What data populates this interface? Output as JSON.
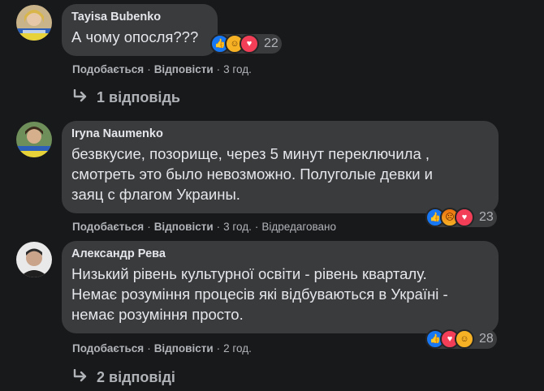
{
  "comments": [
    {
      "author": "Tayisa Bubenko",
      "text": "А чому опосля???",
      "like_label": "Подобається",
      "reply_label": "Відповісти",
      "time": "3 год.",
      "reaction_count": "22",
      "reactions": [
        "like-icon",
        "haha-icon",
        "love-icon"
      ],
      "replies_label": "1 відповідь"
    },
    {
      "author": "Iryna Naumenko",
      "text_lines": [
        "безвкусие, позорище, через 5 минут переключила ,",
        "смотреть это было невозможно. Полуголые девки и",
        "заяц с флагом Украины."
      ],
      "like_label": "Подобається",
      "reply_label": "Відповісти",
      "time": "3 год.",
      "edited": "Відредаговано",
      "reaction_count": "23",
      "reactions": [
        "like-icon",
        "angry-icon",
        "love-icon"
      ]
    },
    {
      "author": "Александр Рева",
      "text_lines": [
        "Низький рівень культурної освіти - рівень кварталу.",
        "Немає розуміння процесів які відбуваються в Україні -",
        "немає розуміння просто."
      ],
      "like_label": "Подобається",
      "reply_label": "Відповісти",
      "time": "2 год.",
      "reaction_count": "28",
      "reactions": [
        "like-icon",
        "love-icon",
        "haha-icon"
      ],
      "replies_label": "2 відповіді"
    }
  ],
  "colors": {
    "background": "#18191a",
    "bubble": "#3a3b3c",
    "text": "#e4e6eb",
    "muted": "#b0b3b8",
    "like": "#1877f2",
    "love": "#f33e58",
    "haha": "#f7b125"
  }
}
